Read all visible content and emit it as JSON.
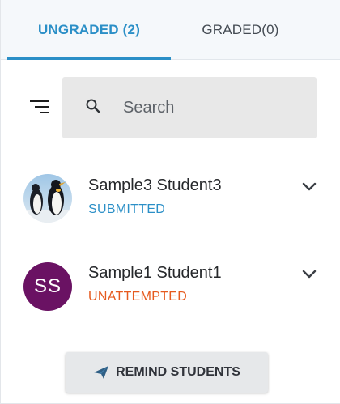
{
  "tabs": {
    "ungraded_label": "UNGRADED (2)",
    "graded_label": "GRADED(0)"
  },
  "search": {
    "placeholder": "Search",
    "value": ""
  },
  "students": [
    {
      "name": "Sample3 Student3",
      "status": "SUBMITTED",
      "status_color": "#2b8fc7",
      "avatar": "penguins-photo"
    },
    {
      "name": "Sample1 Student1",
      "status": "UNATTEMPTED",
      "status_color": "#e65a1e",
      "avatar_initials": "SS",
      "avatar_color": "#6a1263"
    }
  ],
  "remind_button": {
    "label": "REMIND STUDENTS",
    "icon": "paper-plane-icon"
  },
  "colors": {
    "accent": "#2b8fc7",
    "unattempted": "#e65a1e"
  }
}
